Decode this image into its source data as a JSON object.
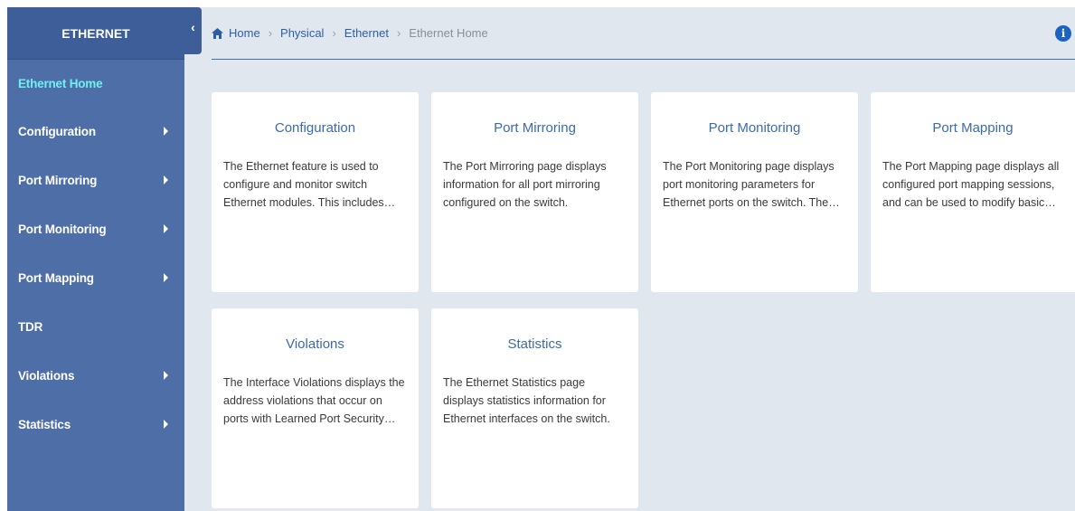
{
  "sidebar": {
    "title": "ETHERNET",
    "items": [
      {
        "label": "Ethernet Home",
        "has_submenu": false,
        "active": true
      },
      {
        "label": "Configuration",
        "has_submenu": true
      },
      {
        "label": "Port Mirroring",
        "has_submenu": true
      },
      {
        "label": "Port Monitoring",
        "has_submenu": true
      },
      {
        "label": "Port Mapping",
        "has_submenu": true
      },
      {
        "label": "TDR",
        "has_submenu": false
      },
      {
        "label": "Violations",
        "has_submenu": true
      },
      {
        "label": "Statistics",
        "has_submenu": true
      }
    ]
  },
  "collapse": {
    "icon": "chevron-left-icon",
    "glyph": "‹"
  },
  "breadcrumb": {
    "items": [
      {
        "label": "Home"
      },
      {
        "label": "Physical"
      },
      {
        "label": "Ethernet"
      },
      {
        "label": "Ethernet Home"
      }
    ],
    "separator": "›"
  },
  "info": {
    "glyph": "i"
  },
  "cards": [
    {
      "title": "Configuration",
      "description": "The Ethernet feature is used to configure and monitor switch Ethernet modules. This includes…"
    },
    {
      "title": "Port Mirroring",
      "description": "The Port Mirroring page displays information for all port mirroring configured on the switch."
    },
    {
      "title": "Port Monitoring",
      "description": "The Port Monitoring page displays port monitoring parameters for Ethernet ports on the switch. The…"
    },
    {
      "title": "Port Mapping",
      "description": "The Port Mapping page displays all configured port mapping sessions, and can be used to modify basic…"
    },
    {
      "title": "Violations",
      "description": "The Interface Violations displays the address violations that occur on ports with Learned Port Security…"
    },
    {
      "title": "Statistics",
      "description": "The Ethernet Statistics page displays statistics information for Ethernet interfaces on the switch."
    }
  ],
  "colors": {
    "sidebar_bg": "#4e6ea7",
    "sidebar_header_bg": "#3d5e99",
    "active_item": "#6ff0f0",
    "link": "#2a5fa8",
    "main_bg": "#e1e7ee",
    "info_icon": "#1b62c4"
  }
}
